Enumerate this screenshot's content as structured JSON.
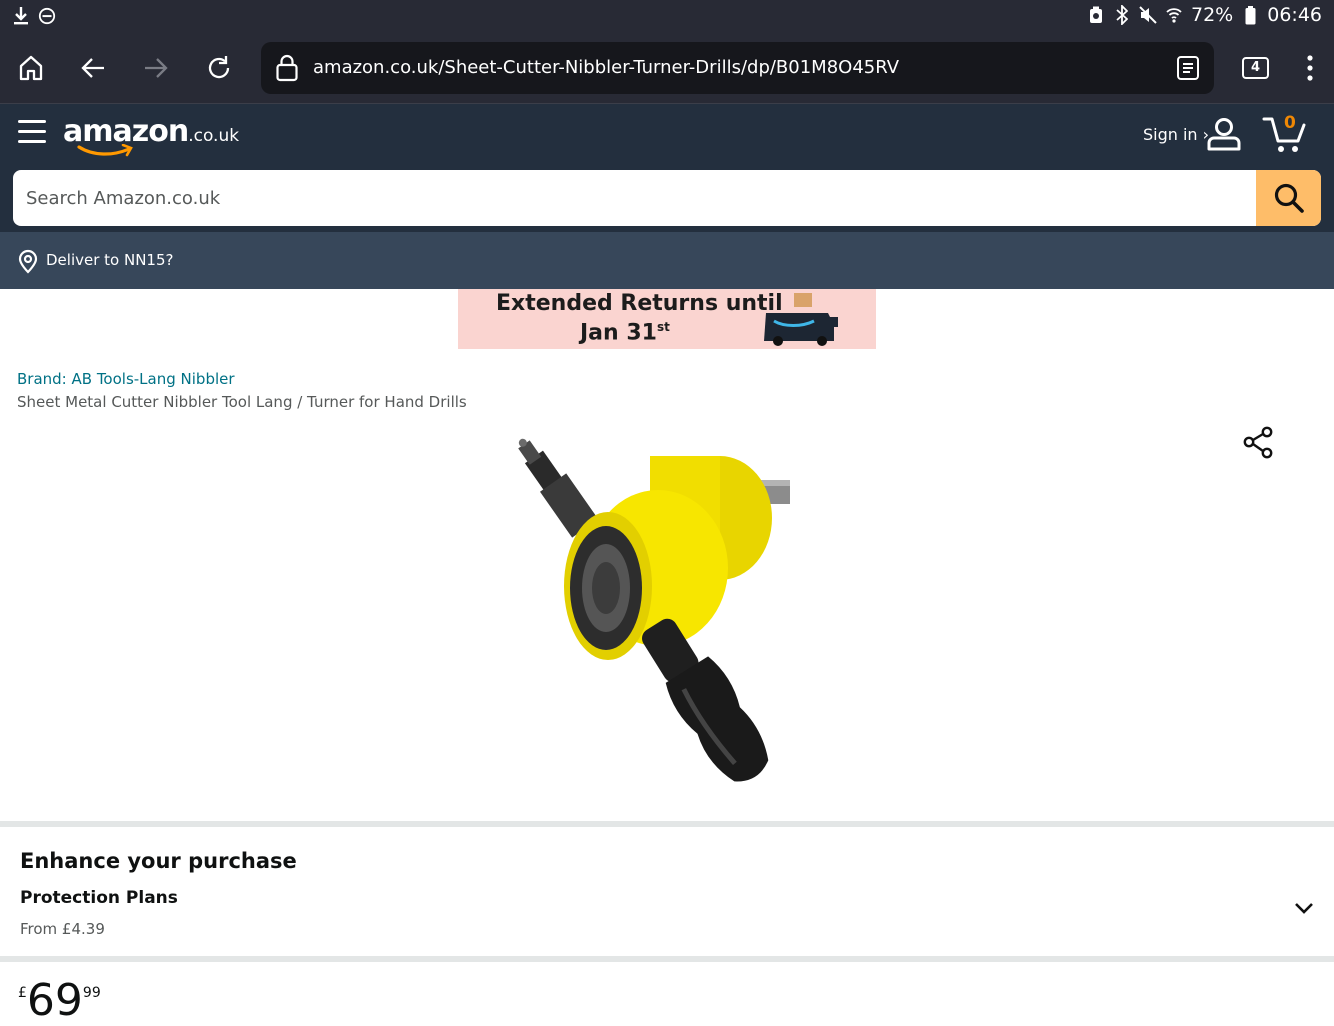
{
  "status_bar": {
    "battery": "72%",
    "time": "06:46"
  },
  "browser": {
    "url": "amazon.co.uk/Sheet-Cutter-Nibbler-Turner-Drills/dp/B01M8O45RV",
    "tab_count": "4"
  },
  "header": {
    "logo_word": "amazon",
    "logo_tld": ".co.uk",
    "sign_in": "Sign in ›",
    "cart_count": "0",
    "search_placeholder": "Search Amazon.co.uk"
  },
  "delivery": {
    "label": "Deliver to NN15?"
  },
  "banner": {
    "line1": "Extended Returns until",
    "line2": "Jan 31",
    "line2_sup": "st"
  },
  "product": {
    "brand": "Brand: AB Tools-Lang Nibbler",
    "title": "Sheet Metal Cutter Nibbler Tool Lang / Turner for Hand Drills"
  },
  "enhance": {
    "heading": "Enhance your purchase",
    "plans_label": "Protection Plans",
    "from_price": "From £4.39"
  },
  "price": {
    "currency": "£",
    "whole": "69",
    "fraction": "99"
  },
  "colors": {
    "header_bg": "#232f3e",
    "deliver_bg": "#37475a",
    "search_button": "#febd69",
    "cart_accent": "#f08804",
    "link": "#007185",
    "banner_bg": "#fad4d0"
  }
}
